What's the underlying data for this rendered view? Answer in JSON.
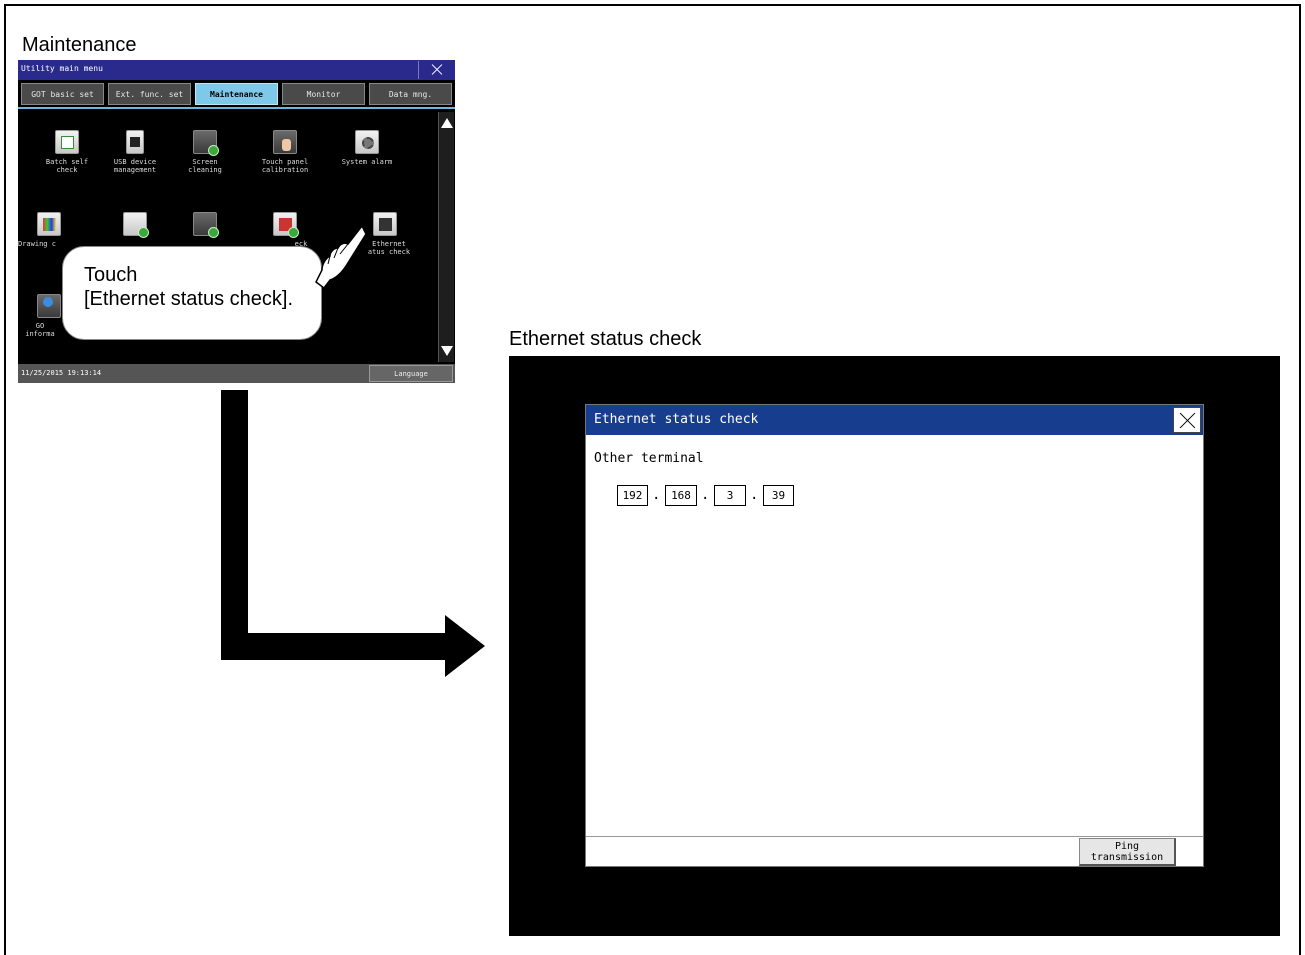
{
  "captions": {
    "maintenance": "Maintenance",
    "ethernet": "Ethernet status check"
  },
  "utility_menu": {
    "title": "Utility main menu",
    "tabs": [
      {
        "label": "GOT basic set",
        "active": false
      },
      {
        "label": "Ext. func. set",
        "active": false
      },
      {
        "label": "Maintenance",
        "active": true
      },
      {
        "label": "Monitor",
        "active": false
      },
      {
        "label": "Data mng.",
        "active": false
      }
    ],
    "icons": [
      {
        "label": "Batch self\ncheck",
        "icon": "checklist-icon"
      },
      {
        "label": "USB device\nmanagement",
        "icon": "usb-icon"
      },
      {
        "label": "Screen\ncleaning",
        "icon": "screen-cleaning-icon"
      },
      {
        "label": "Touch panel\ncalibration",
        "icon": "touch-calibration-icon"
      },
      {
        "label": "System alarm",
        "icon": "system-alarm-icon"
      },
      {
        "label": "Drawing c",
        "icon": "drawing-check-icon"
      },
      {
        "label": "",
        "icon": "copy-check-icon"
      },
      {
        "label": "",
        "icon": "touch-check-icon"
      },
      {
        "label": "eck",
        "icon": "memory-check-icon"
      },
      {
        "label": "Ethernet\natus check",
        "icon": "ethernet-icon"
      },
      {
        "label": "GO\ninforma",
        "icon": "info-icon"
      }
    ],
    "datetime": "11/25/2015 19:13:14",
    "language_button": "Language"
  },
  "callout": {
    "text": "Touch\n[Ethernet status check]."
  },
  "ethernet_dialog": {
    "title": "Ethernet status check",
    "label": "Other terminal",
    "ip": [
      "192",
      "168",
      "3",
      "39"
    ],
    "ping_button": "Ping\ntransmission"
  }
}
